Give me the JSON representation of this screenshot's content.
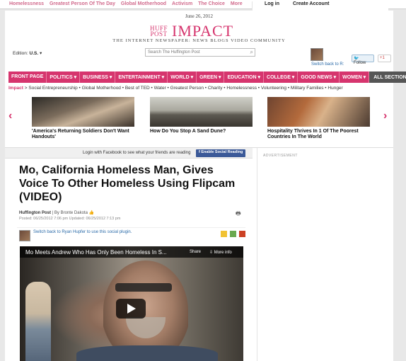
{
  "topbar": {
    "links": [
      "Homelessness",
      "Greatest Person Of The Day",
      "Global Motherhood",
      "Activism",
      "The Choice",
      "More"
    ],
    "login": "Log in",
    "create_account": "Create Account"
  },
  "masthead": {
    "date": "June 26, 2012",
    "logo_huff": "HUFF",
    "logo_post": "POST",
    "section": "IMPACT",
    "tagline": "THE INTERNET NEWSPAPER: NEWS BLOGS VIDEO COMMUNITY"
  },
  "edition": {
    "label": "Edition:",
    "value": "U.S.",
    "arrow": "▾"
  },
  "search": {
    "placeholder": "Search The Huffington Post"
  },
  "user": {
    "switch_back": "Switch back to R:"
  },
  "social_buttons": {
    "twitter": "Follow",
    "gplus": "+1"
  },
  "nav": {
    "items": [
      "FRONT PAGE",
      "POLITICS ▾",
      "BUSINESS ▾",
      "ENTERTAINMENT ▾",
      "WORLD ▾",
      "GREEN ▾",
      "EDUCATION ▾",
      "COLLEGE ▾",
      "GOOD NEWS ▾",
      "WOMEN ▾"
    ],
    "all_sections": "ALL SECTIONS ▾"
  },
  "subnav": {
    "lead": "Impact",
    "sep": ">",
    "items": [
      "Social Entrepreneurship",
      "Global Motherhood",
      "Best of TED",
      "Water",
      "Greatest Person",
      "Charity",
      "Homelessness",
      "Volunteering",
      "Military Families",
      "Hunger"
    ]
  },
  "carousel": {
    "prev": "‹",
    "next": "›",
    "cards": [
      {
        "caption": "'America's Returning Soldiers Don't Want Handouts'"
      },
      {
        "caption": "How Do You Stop A Sand Dune?"
      },
      {
        "caption": "Hospitality Thrives In 1 Of The Poorest Countries In The World"
      }
    ]
  },
  "facebook_bar": {
    "text": "Login with Facebook to see what your friends are reading",
    "button": "f  Enable Social Reading"
  },
  "article": {
    "headline": "Mo, California Homeless Man, Gives Voice To Other Homeless Using Flipcam (VIDEO)",
    "source": "Huffington Post",
    "by": "| By Bronte Dakota",
    "posted": "Posted: 06/25/2012 7:06 pm Updated: 06/25/2012 7:13 pm",
    "social_switch": "Switch back to Ryan Hupfer to use this social plugin."
  },
  "video": {
    "title": "Mo Meets Andrew Who Has Only Been Homeless In S...",
    "share": "Share",
    "more_info": "More info"
  },
  "sidebar": {
    "ad_label": "ADVERTISEMENT"
  }
}
